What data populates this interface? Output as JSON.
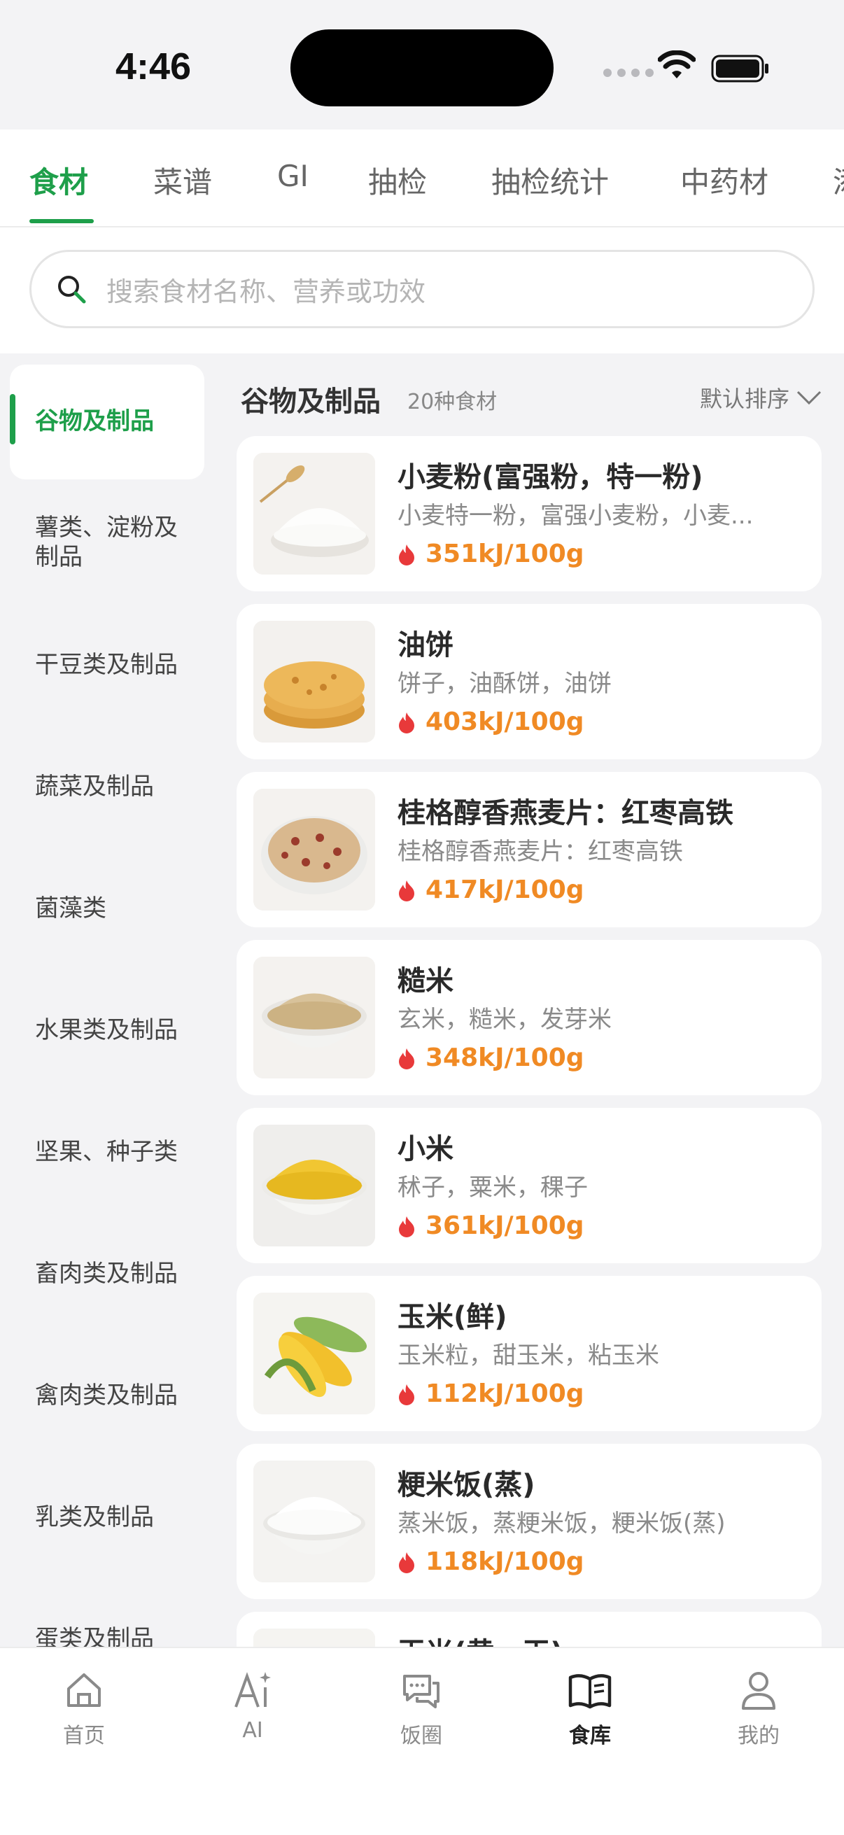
{
  "status": {
    "time": "4:46"
  },
  "tabs": [
    {
      "label": "食材",
      "active": true
    },
    {
      "label": "菜谱"
    },
    {
      "label": "GI"
    },
    {
      "label": "抽检"
    },
    {
      "label": "抽检统计"
    },
    {
      "label": "中药材"
    },
    {
      "label": "添"
    }
  ],
  "search": {
    "placeholder": "搜索食材名称、营养或功效"
  },
  "categories": [
    {
      "label": "谷物及制品",
      "active": true
    },
    {
      "label": "薯类、淀粉及制品"
    },
    {
      "label": "干豆类及制品"
    },
    {
      "label": "蔬菜及制品"
    },
    {
      "label": "菌藻类"
    },
    {
      "label": "水果类及制品"
    },
    {
      "label": "坚果、种子类"
    },
    {
      "label": "畜肉类及制品"
    },
    {
      "label": "禽肉类及制品"
    },
    {
      "label": "乳类及制品"
    },
    {
      "label": "蛋类及制品"
    }
  ],
  "list": {
    "title": "谷物及制品",
    "count": "20种食材",
    "sort_label": "默认排序"
  },
  "foods": [
    {
      "name": "小麦粉(富强粉，特一粉)",
      "alias": "小麦特一粉，富强小麦粉，小麦...",
      "energy": "351kJ/100g",
      "image": "flour-bowl"
    },
    {
      "name": "油饼",
      "alias": "饼子，油酥饼，油饼",
      "energy": "403kJ/100g",
      "image": "flatbread-stack"
    },
    {
      "name": "桂格醇香燕麦片：红枣高铁",
      "alias": "桂格醇香燕麦片：红枣高铁",
      "energy": "417kJ/100g",
      "image": "oat-bowl"
    },
    {
      "name": "糙米",
      "alias": "玄米，糙米，发芽米",
      "energy": "348kJ/100g",
      "image": "brown-rice-bowl"
    },
    {
      "name": "小米",
      "alias": "秫子，粟米，稞子",
      "energy": "361kJ/100g",
      "image": "millet-bowl"
    },
    {
      "name": "玉米(鲜)",
      "alias": "玉米粒，甜玉米，粘玉米",
      "energy": "112kJ/100g",
      "image": "corn-cobs"
    },
    {
      "name": "粳米饭(蒸)",
      "alias": "蒸米饭，蒸粳米饭，粳米饭(蒸)",
      "energy": "118kJ/100g",
      "image": "rice-bowl"
    },
    {
      "name": "玉米(黄，干)",
      "alias": "",
      "energy": "",
      "image": "dry-corn"
    }
  ],
  "nav": [
    {
      "label": "首页",
      "icon": "home-icon"
    },
    {
      "label": "AI",
      "icon": "ai-icon"
    },
    {
      "label": "饭圈",
      "icon": "chat-icon"
    },
    {
      "label": "食库",
      "icon": "book-icon",
      "active": true
    },
    {
      "label": "我的",
      "icon": "person-icon"
    }
  ],
  "colors": {
    "accent": "#1e9f4a",
    "energy": "#f08a24",
    "flame": "#e8393a"
  }
}
